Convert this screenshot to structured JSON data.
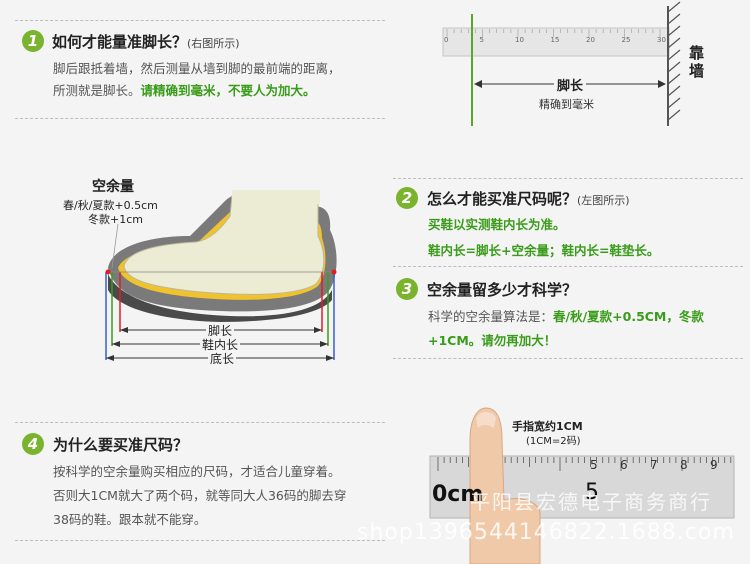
{
  "section1": {
    "num": "1",
    "title": "如何才能量准脚长？",
    "note": "(右图所示)",
    "line1": "脚后跟抵着墙，然后测量从墙到脚的最前端的距离，",
    "line2_plain": "所测就是脚长。",
    "line2_green": "请精确到毫米，不要人为加大。"
  },
  "ruler_top": {
    "ticks": [
      "0",
      "5",
      "10",
      "15",
      "20",
      "25",
      "30"
    ],
    "wall_label": "靠墙",
    "length_label": "脚长",
    "precision_label": "精确到毫米"
  },
  "diagram": {
    "space_title": "空余量",
    "space_line1": "春/秋/夏款+0.5cm",
    "space_line2": "冬款+1cm",
    "foot_length": "脚长",
    "inner_length": "鞋内长",
    "sole_length": "底长"
  },
  "section2": {
    "num": "2",
    "title": "怎么才能买准尺码呢？",
    "note": "(左图所示)",
    "line1": "买鞋以实测鞋内长为准。",
    "line2": "鞋内长=脚长+空余量；鞋内长=鞋垫长。"
  },
  "section3": {
    "num": "3",
    "title": "空余量留多少才科学？",
    "line1_plain": "科学的空余量算法是：",
    "line1_green": "春/秋/夏款+0.5CM，冬款",
    "line2_green": "+1CM。请勿再加大！"
  },
  "section4": {
    "num": "4",
    "title": "为什么要买准尺码？",
    "line1": "按科学的空余量购买相应的尺码，才适合儿童穿着。",
    "line2": "否则大1CM就大了两个码，就等同大人36码的脚去穿",
    "line3": "38码的鞋。跟本就不能穿。"
  },
  "finger": {
    "title": "手指宽约1CM",
    "sub": "(1CM=2码)",
    "ruler_zero": "0cm",
    "ruler_ticks": [
      "5",
      "6",
      "7",
      "8",
      "9"
    ],
    "ruler_five": "5"
  },
  "watermark": {
    "store": "平阳县宏德电子商务商行",
    "url": "shop1396544146822.1688.com"
  },
  "colors": {
    "accent_green": "#7ab32e",
    "text_green": "#3a9c1a",
    "red": "#e02020",
    "blue": "#3a5fd0"
  }
}
